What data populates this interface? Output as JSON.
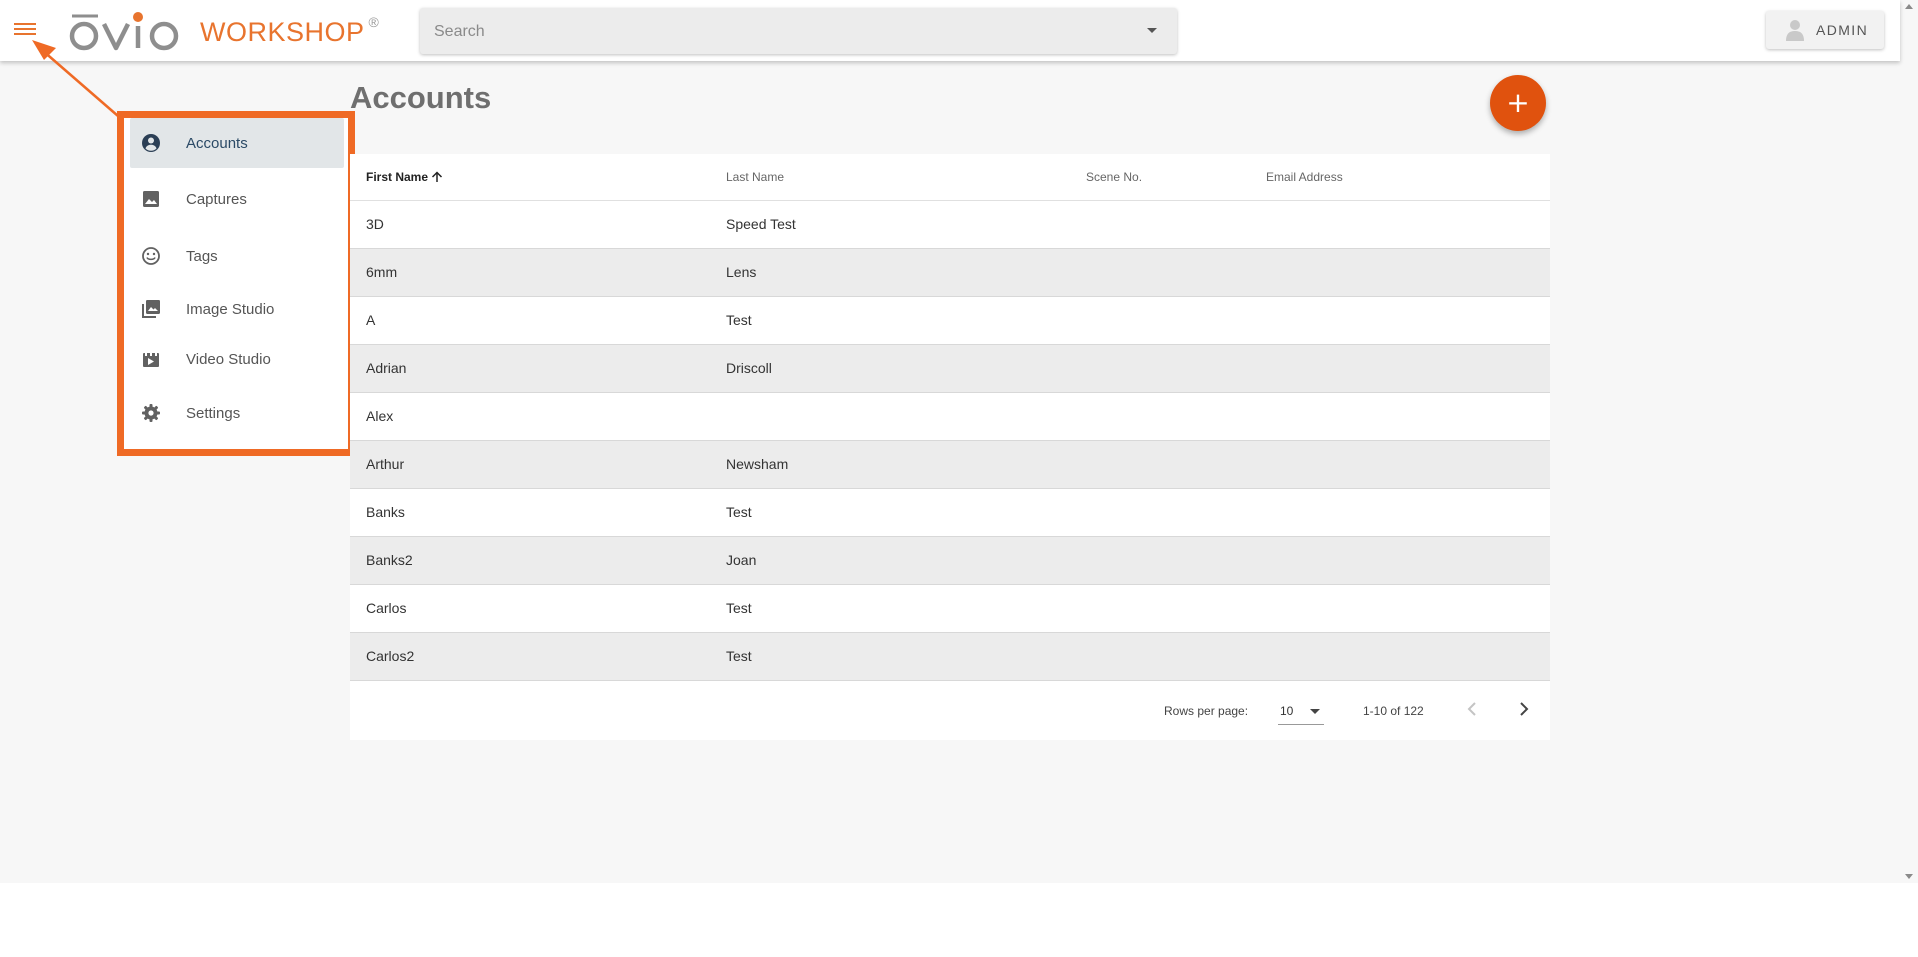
{
  "app": {
    "logo_text": "ovio",
    "brand": "WORKSHOP",
    "reg_mark": "®",
    "accent_color": "#e8742e",
    "fab_color": "#e0520e",
    "highlight_color": "#ef6a25"
  },
  "header": {
    "menu_icon": "hamburger-menu-icon",
    "search": {
      "placeholder": "Search",
      "value": ""
    },
    "user_button": {
      "label": "ADMIN",
      "icon": "person-icon"
    }
  },
  "sidebar": {
    "items": [
      {
        "label": "Accounts",
        "icon": "account-circle-icon",
        "active": true
      },
      {
        "label": "Captures",
        "icon": "image-icon",
        "active": false
      },
      {
        "label": "Tags",
        "icon": "smiley-face-icon",
        "active": false
      },
      {
        "label": "Image Studio",
        "icon": "photo-library-icon",
        "active": false
      },
      {
        "label": "Video Studio",
        "icon": "movie-clapper-icon",
        "active": false
      },
      {
        "label": "Settings",
        "icon": "gear-icon",
        "active": false
      }
    ]
  },
  "main": {
    "title": "Accounts",
    "add_button": {
      "label": "+",
      "icon": "plus-icon"
    },
    "table": {
      "columns": [
        "First Name",
        "Last Name",
        "Scene No.",
        "Email Address"
      ],
      "sort": {
        "column": "First Name",
        "direction": "ascending",
        "icon": "arrow-up-icon"
      },
      "rows": [
        {
          "first": "3D",
          "last": "Speed Test",
          "scene": "",
          "email": ""
        },
        {
          "first": "6mm",
          "last": "Lens",
          "scene": "",
          "email": ""
        },
        {
          "first": "A",
          "last": "Test",
          "scene": "",
          "email": ""
        },
        {
          "first": "Adrian",
          "last": "Driscoll",
          "scene": "",
          "email": ""
        },
        {
          "first": "Alex",
          "last": "",
          "scene": "",
          "email": ""
        },
        {
          "first": "Arthur",
          "last": "Newsham",
          "scene": "",
          "email": ""
        },
        {
          "first": "Banks",
          "last": "Test",
          "scene": "",
          "email": ""
        },
        {
          "first": "Banks2",
          "last": "Joan",
          "scene": "",
          "email": ""
        },
        {
          "first": "Carlos",
          "last": "Test",
          "scene": "",
          "email": ""
        },
        {
          "first": "Carlos2",
          "last": "Test",
          "scene": "",
          "email": ""
        }
      ]
    },
    "pagination": {
      "rows_per_page_label": "Rows per page:",
      "rows_per_page": "10",
      "range": "1-10 of 122",
      "prev_icon": "chevron-left-icon",
      "next_icon": "chevron-right-icon"
    }
  }
}
